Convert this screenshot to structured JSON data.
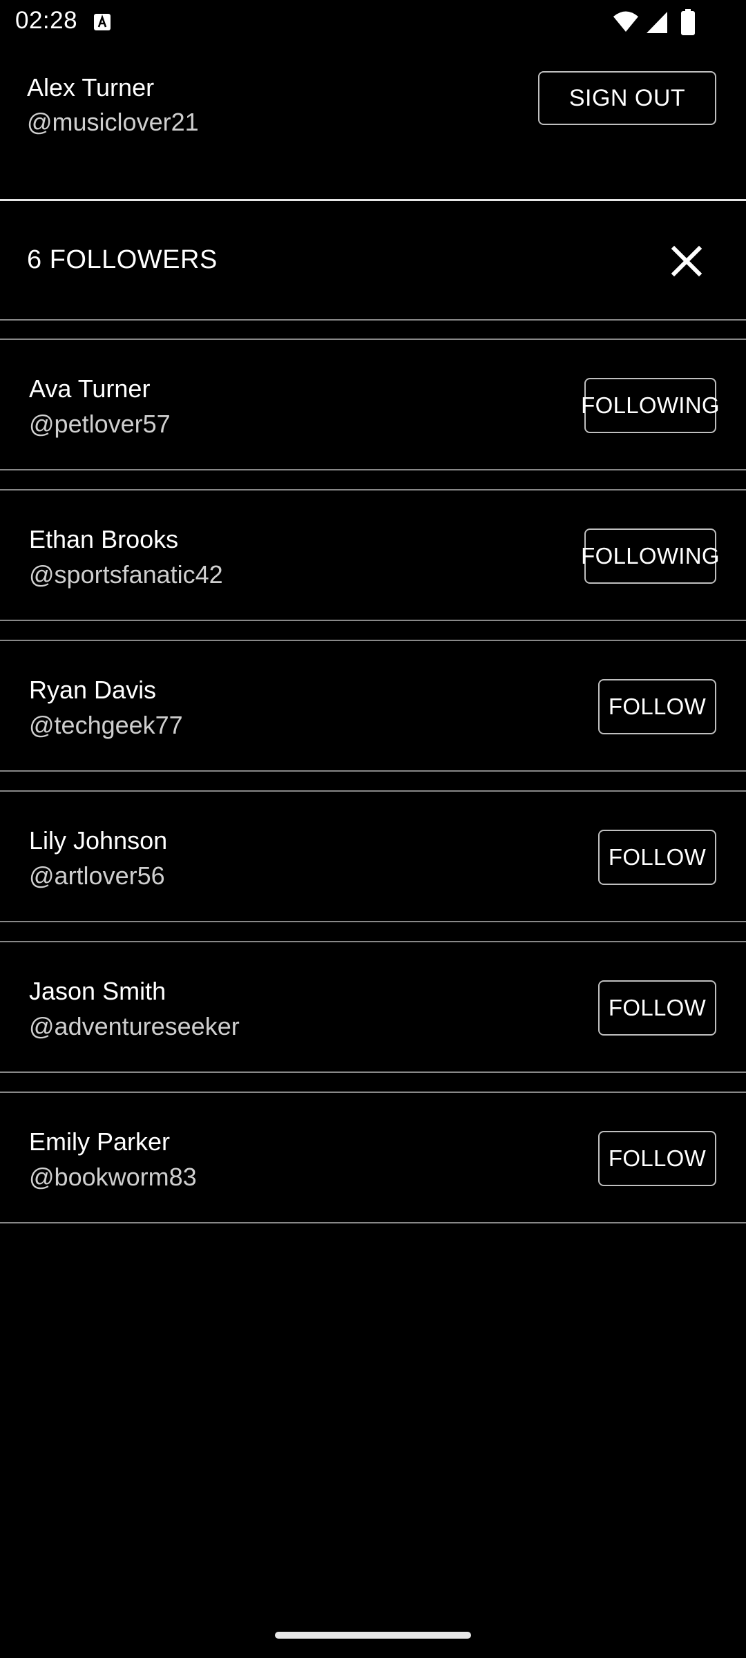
{
  "status_bar": {
    "time": "02:28",
    "icons": [
      "a-notification-icon",
      "wifi-icon",
      "signal-icon",
      "battery-icon"
    ]
  },
  "profile": {
    "name": "Alex Turner",
    "handle": "@musiclover21",
    "sign_out_label": "SIGN OUT"
  },
  "followers_panel": {
    "title": "6 FOLLOWERS",
    "close_icon": "close-icon"
  },
  "followers": [
    {
      "name": "Ava Turner",
      "handle": "@petlover57",
      "button": "FOLLOWING",
      "state": "following"
    },
    {
      "name": "Ethan Brooks",
      "handle": "@sportsfanatic42",
      "button": "FOLLOWING",
      "state": "following"
    },
    {
      "name": "Ryan Davis",
      "handle": "@techgeek77",
      "button": "FOLLOW",
      "state": "follow"
    },
    {
      "name": "Lily Johnson",
      "handle": "@artlover56",
      "button": "FOLLOW",
      "state": "follow"
    },
    {
      "name": "Jason Smith",
      "handle": "@adventureseeker",
      "button": "FOLLOW",
      "state": "follow"
    },
    {
      "name": "Emily Parker",
      "handle": "@bookworm83",
      "button": "FOLLOW",
      "state": "follow"
    }
  ],
  "colors": {
    "background": "#000000",
    "text": "#ffffff",
    "secondary_text": "#cfcfcf",
    "divider": "#888888",
    "button_border": "#bfbfbf"
  }
}
